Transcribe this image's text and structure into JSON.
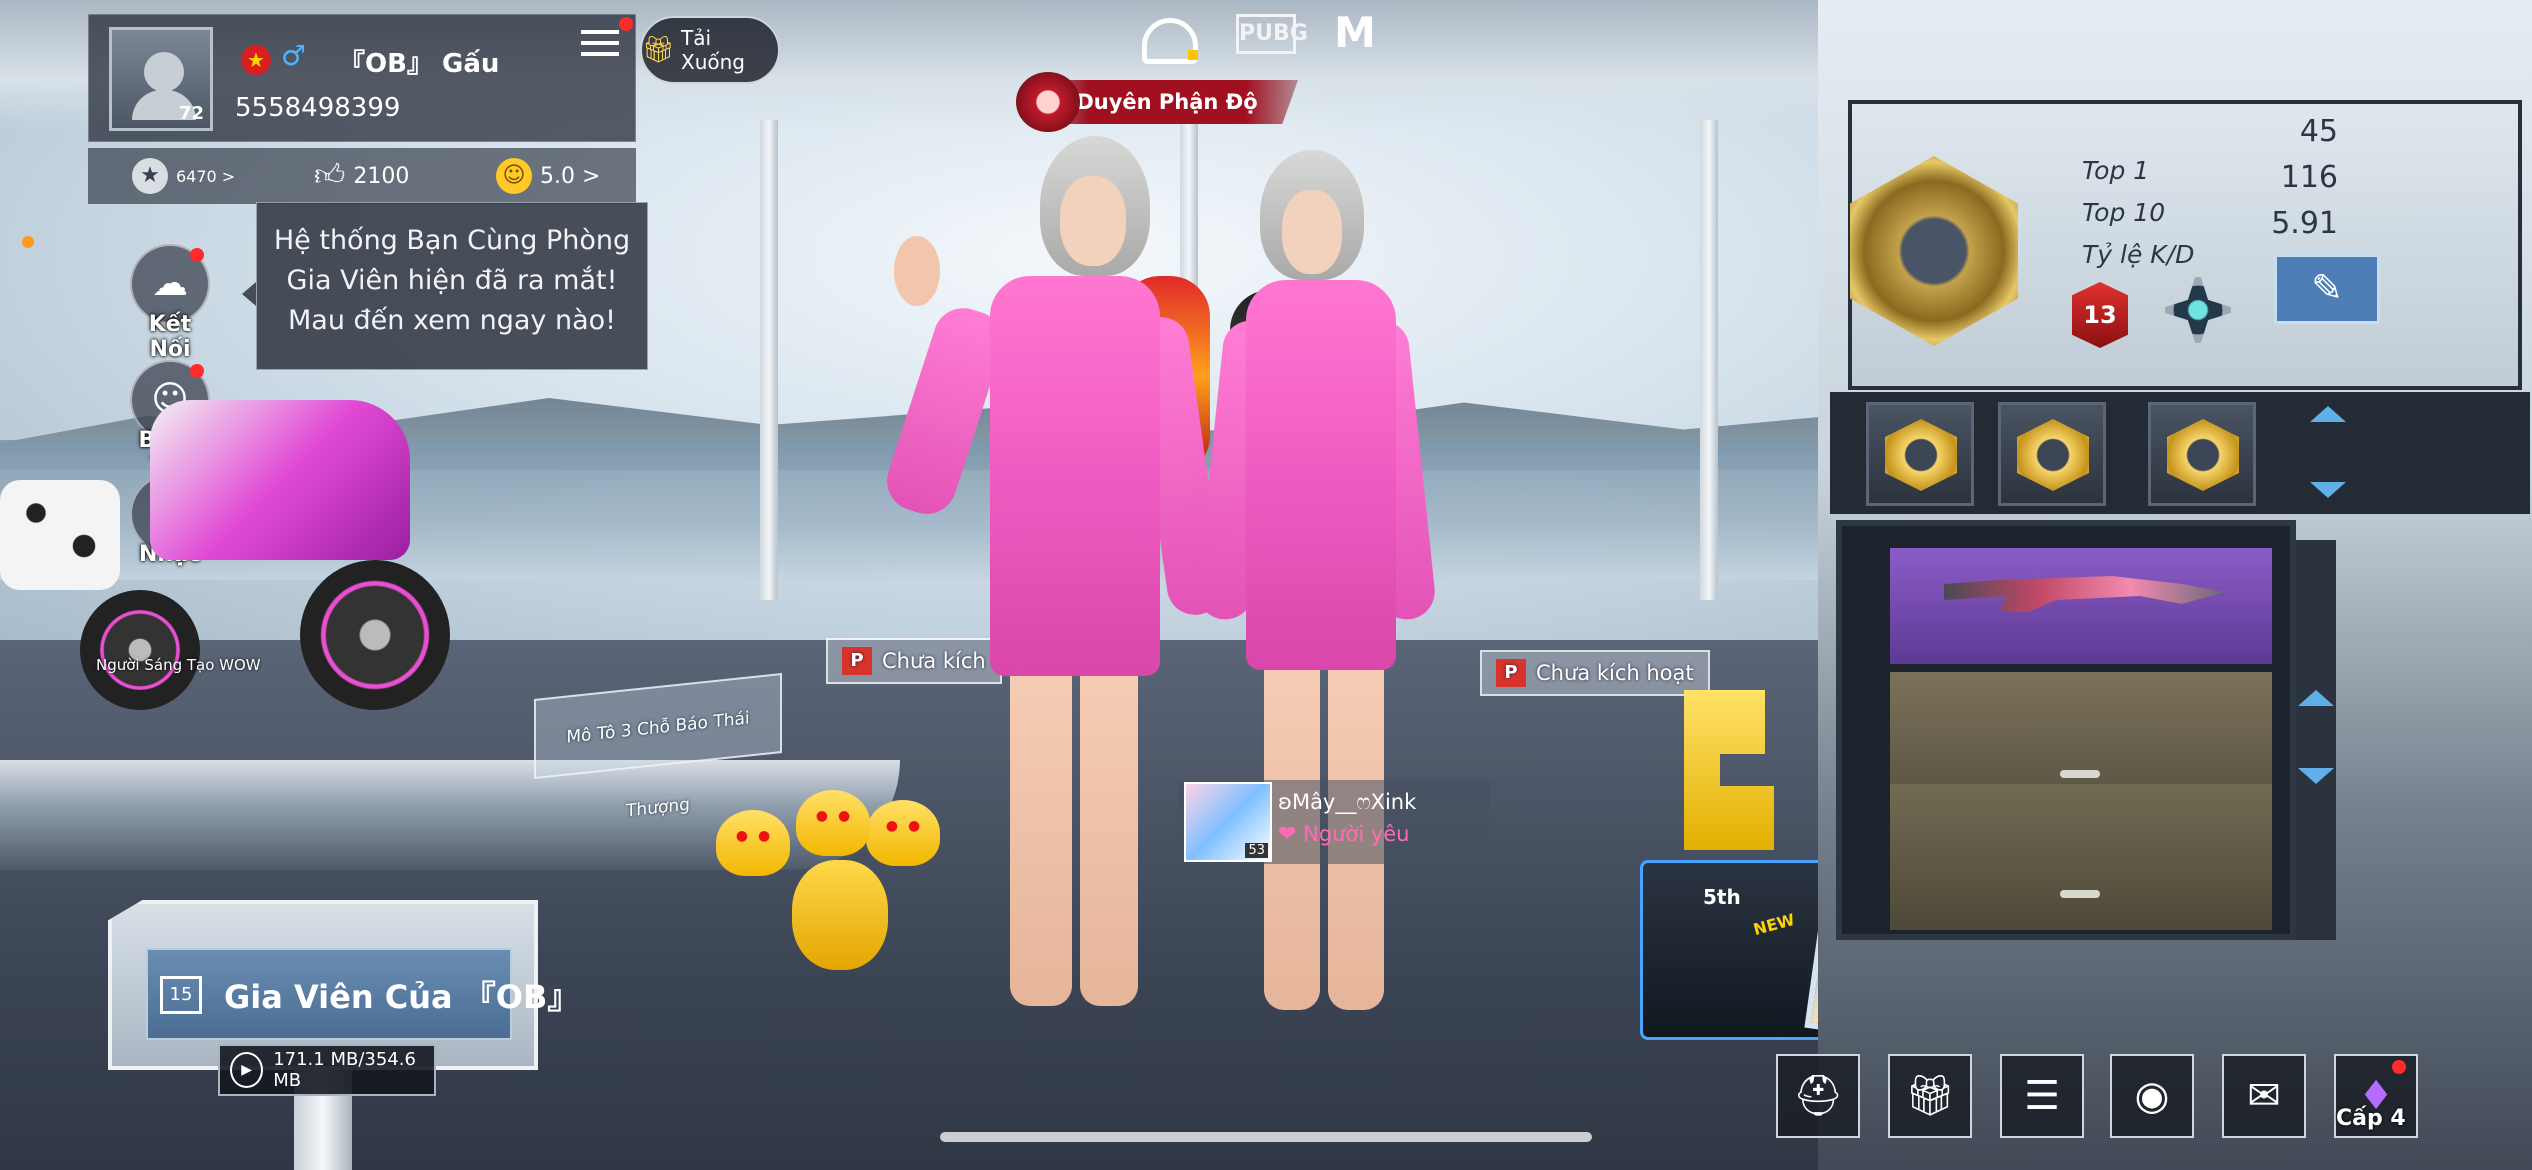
{
  "player": {
    "level": "72",
    "name": "『OB』 Gấu",
    "id": "5558498399",
    "popularity": "6470 >",
    "likes": "2100",
    "rating": "5.0 >"
  },
  "download_button": {
    "label": "Tải Xuống"
  },
  "tooltip": {
    "line1": "Hệ thống Bạn Cùng Phòng",
    "line2": "Gia Viên hiện đã ra mắt!",
    "line3": "Mau đến xem ngay nào!"
  },
  "side_menu": {
    "items": [
      {
        "label": "Kết Nối",
        "icon": "connect-icon"
      },
      {
        "label": "Bảng Tin",
        "icon": "news-icon"
      },
      {
        "label": "Nhạc",
        "icon": "music-icon"
      }
    ]
  },
  "scene": {
    "bike_creator": "Người Sáng Tạo WOW",
    "platform_sign": "Mô Tô 3 Chỗ Báo Thái Thượng",
    "title_banner": "Duyên Phận Độ",
    "inactive_tag_left": "Chưa kích",
    "inactive_tag_right": "Chưa kích hoạt",
    "tag_icon": "P",
    "trophy_label": "5th",
    "crate_new": "NEW"
  },
  "partner": {
    "name": "ʚMây__ෆXink",
    "relation": "Người yêu",
    "level": "53"
  },
  "stats_board": {
    "top1_label": "Top 1",
    "top1_value": "45",
    "top10_label": "Top 10",
    "top10_value": "116",
    "kd_label": "Tỷ lệ K/D",
    "kd_value": "5.91",
    "rank_number": "13"
  },
  "home_sign": {
    "label": "Gia Viên Của 『OB』",
    "icon_text": "15",
    "download_progress": "171.1 MB/354.6 MB"
  },
  "toolbar": {
    "level_label": "Cấp 4"
  },
  "top_bar": {
    "pubg_logo": "PUBG"
  }
}
